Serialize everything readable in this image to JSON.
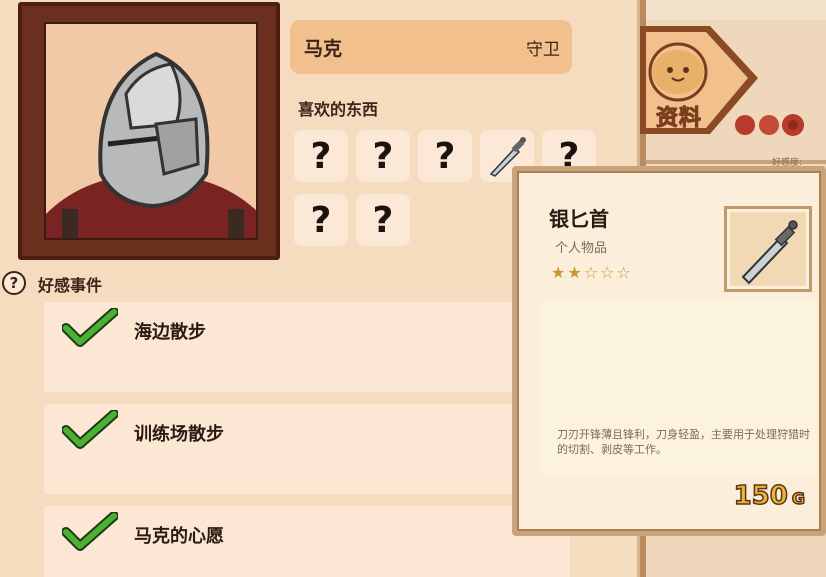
{
  "character": {
    "name": "马克",
    "role": "守卫"
  },
  "likes": {
    "title": "喜欢的东西",
    "slots": [
      "?",
      "?",
      "?",
      "dagger",
      "?",
      "?",
      "?"
    ]
  },
  "events": {
    "title": "好感事件",
    "help": "?",
    "items": [
      {
        "label": "海边散步",
        "done": true
      },
      {
        "label": "训练场散步",
        "done": true
      },
      {
        "label": "马克的心愿",
        "done": true
      }
    ]
  },
  "side_tab": {
    "label": "资料",
    "hint": "好感度:"
  },
  "tooltip": {
    "name": "银匕首",
    "category": "个人物品",
    "rating": 2,
    "rating_max": 5,
    "description": "刀刃开锋薄且锋利，刀身轻盈，主要用于处理狩猎时的切割、剥皮等工作。",
    "price": "150",
    "price_unit": "G"
  },
  "colors": {
    "accent": "#f2c08c",
    "frame": "#6b2f1d",
    "check": "#3aa02a",
    "price": "#e9b53a"
  }
}
